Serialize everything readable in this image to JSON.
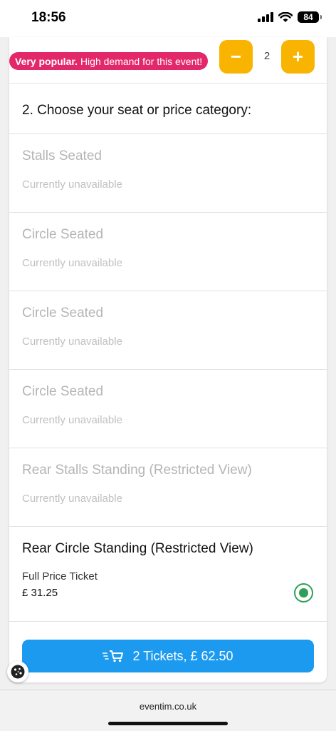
{
  "status_bar": {
    "time": "18:56",
    "battery": "84"
  },
  "quantity": {
    "badge_strong": "Very popular.",
    "badge_text": "High demand for this event!",
    "minus_label": "−",
    "plus_label": "+",
    "value": "2"
  },
  "section": {
    "title": "2. Choose your seat or price category:"
  },
  "categories": [
    {
      "name": "Stalls Seated",
      "status": "Currently unavailable"
    },
    {
      "name": "Circle Seated",
      "status": "Currently unavailable"
    },
    {
      "name": "Circle Seated",
      "status": "Currently unavailable"
    },
    {
      "name": "Circle Seated",
      "status": "Currently unavailable"
    },
    {
      "name": "Rear Stalls Standing (Restricted View)",
      "status": "Currently unavailable"
    }
  ],
  "selected_category": {
    "name": "Rear Circle Standing (Restricted View)",
    "ticket_type": "Full Price Ticket",
    "price": "£ 31.25"
  },
  "cta": {
    "label": "2 Tickets, £ 62.50"
  },
  "browser": {
    "url": "eventim.co.uk"
  },
  "colors": {
    "accent": "#1c9af0",
    "qty_button": "#f8b400",
    "badge": "#e3286a",
    "selected": "#2e9f55"
  }
}
